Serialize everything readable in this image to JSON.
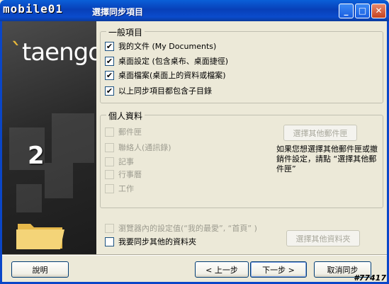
{
  "window": {
    "brand": "mobile01",
    "title": "選擇同步項目"
  },
  "sidebar": {
    "logo": "taengo",
    "step": "2"
  },
  "general": {
    "label": "一般項目",
    "items": [
      {
        "label": "我的文件 (My Documents)",
        "checked": true
      },
      {
        "label": "桌面設定 (包含桌布、桌面捷徑)",
        "checked": true
      },
      {
        "label": "桌面檔案(桌面上的資料或檔案)",
        "checked": true
      },
      {
        "label": "以上同步項目都包含子目錄",
        "checked": true
      }
    ]
  },
  "personal": {
    "label": "個人資料",
    "items": [
      {
        "label": "郵件匣"
      },
      {
        "label": "聯絡人(通訊錄)"
      },
      {
        "label": "記事"
      },
      {
        "label": "行事曆"
      },
      {
        "label": "工作"
      }
    ],
    "choose_mailbox": "選擇其他郵件匣",
    "note": "如果您想選擇其他郵件匣或撤銷件設定，請點 “選擇其他郵件匣”"
  },
  "other": {
    "browser_favorites": "瀏覽器內的設定值(“我的最愛”, “首頁” )",
    "sync_other_folders": "我要同步其他的資料夾",
    "choose_folder": "選擇其他資料夾"
  },
  "footer": {
    "help": "說明",
    "back": "< 上一步",
    "next": "下一步 >",
    "cancel": "取消同步",
    "watermark": "#77417"
  }
}
